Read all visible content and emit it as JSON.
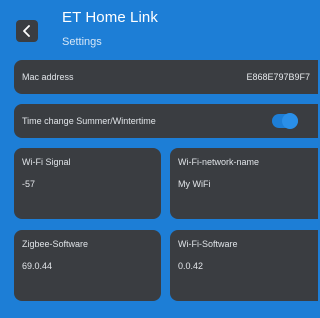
{
  "header": {
    "title": "ET Home Link",
    "subtitle": "Settings",
    "back_icon": "chevron-left-icon"
  },
  "mac": {
    "label": "Mac address",
    "value": "E868E797B9F7"
  },
  "time_change": {
    "label": "Time change Summer/Wintertime",
    "enabled": true
  },
  "cards": {
    "wifi_signal": {
      "label": "Wi-Fi Signal",
      "value": "-57"
    },
    "wifi_network": {
      "label": "Wi-Fi-network-name",
      "value": "My WiFi"
    },
    "zigbee_software": {
      "label": "Zigbee-Software",
      "value": "69.0.44"
    },
    "wifi_software": {
      "label": "Wi-Fi-Software",
      "value": "0.0.42"
    }
  },
  "colors": {
    "background": "#1d7ed6",
    "card": "#3a3d41",
    "toggle_on": "#2a8fe8"
  }
}
